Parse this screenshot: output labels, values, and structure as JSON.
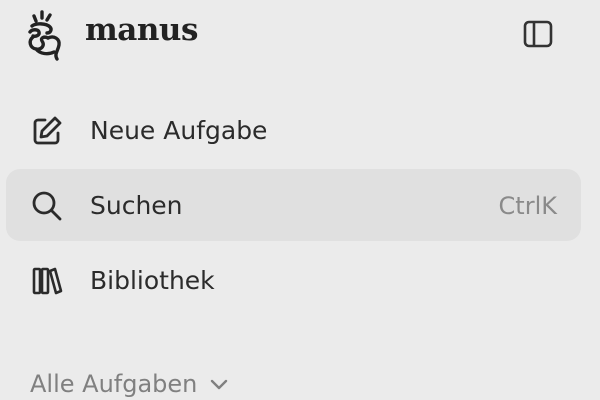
{
  "header": {
    "brand_name": "manus",
    "logo_icon": "hand-logo-icon",
    "toggle_icon": "sidebar-toggle-icon"
  },
  "nav": {
    "items": [
      {
        "label": "Neue Aufgabe",
        "icon": "edit-icon",
        "shortcut": "",
        "active": false
      },
      {
        "label": "Suchen",
        "icon": "search-icon",
        "shortcut": "CtrlK",
        "active": true
      },
      {
        "label": "Bibliothek",
        "icon": "library-icon",
        "shortcut": "",
        "active": false
      }
    ]
  },
  "section": {
    "label": "Alle Aufgaben",
    "icon": "chevron-down-icon"
  },
  "colors": {
    "background": "#ebebeb",
    "active_item": "#e0e0e0",
    "text": "#2b2b2b",
    "muted": "#8a8a8a"
  }
}
